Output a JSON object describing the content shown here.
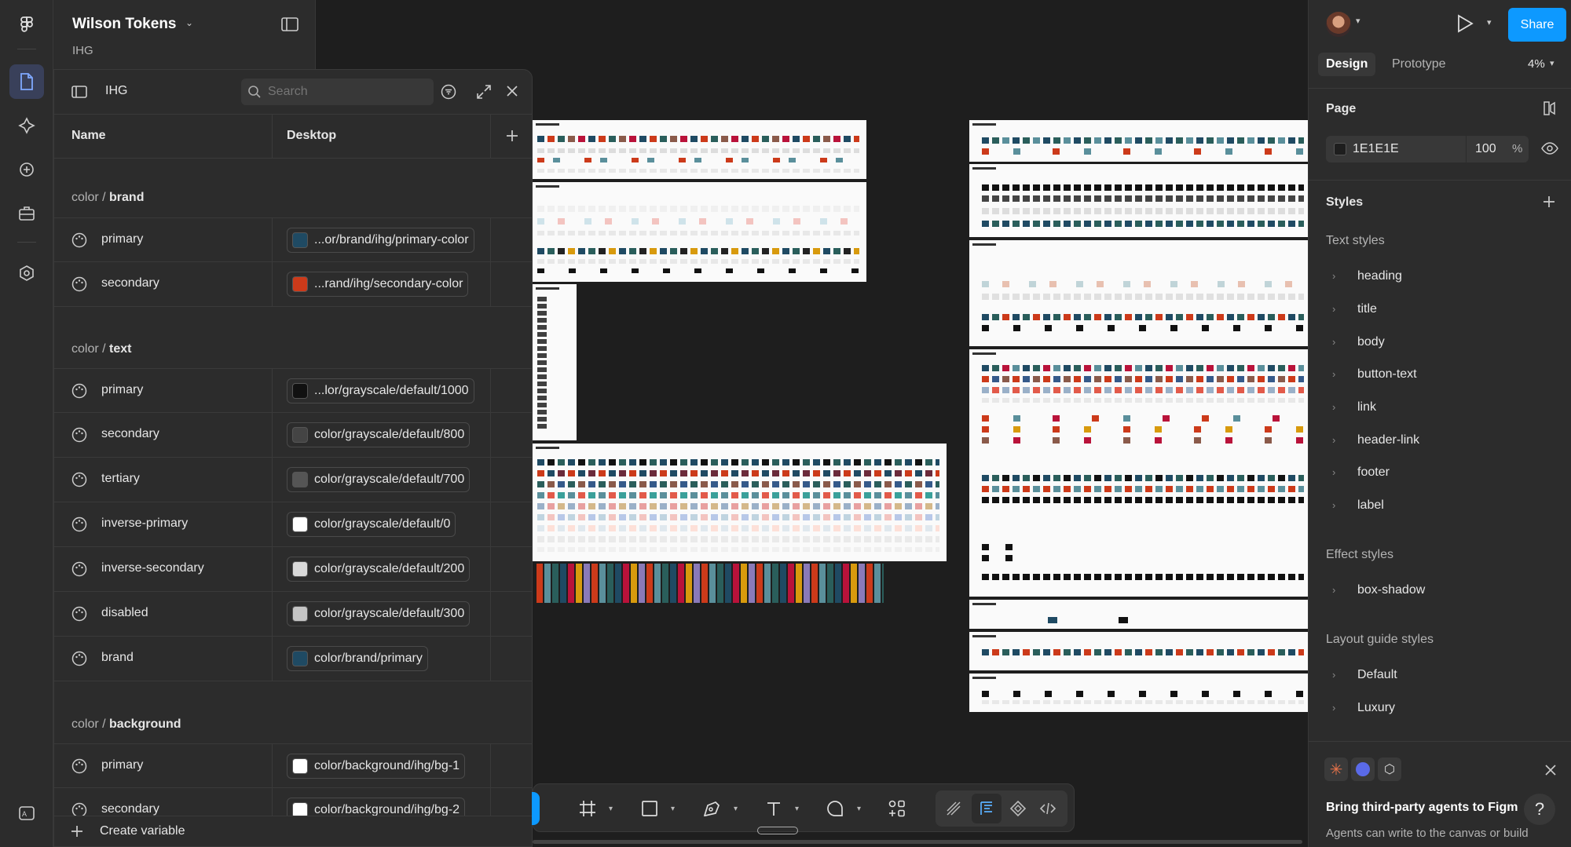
{
  "file": {
    "title": "Wilson Tokens",
    "subtitle": "IHG"
  },
  "variables_panel": {
    "collection": "IHG",
    "search_placeholder": "Search",
    "col_name": "Name",
    "col_mode": "Desktop",
    "groups": [
      {
        "prefix": "color / ",
        "name": "brand"
      },
      {
        "prefix": "color / ",
        "name": "text"
      },
      {
        "prefix": "color / ",
        "name": "background"
      }
    ],
    "rows": [
      {
        "name": "primary",
        "value": "...or/brand/ihg/primary-color",
        "color": "#1f4a63"
      },
      {
        "name": "secondary",
        "value": "...rand/ihg/secondary-color",
        "color": "#cc3a1a"
      },
      {
        "name": "primary",
        "value": "...lor/grayscale/default/1000",
        "color": "#111111"
      },
      {
        "name": "secondary",
        "value": "color/grayscale/default/800",
        "color": "#444444"
      },
      {
        "name": "tertiary",
        "value": "color/grayscale/default/700",
        "color": "#555555"
      },
      {
        "name": "inverse-primary",
        "value": "color/grayscale/default/0",
        "color": "#ffffff"
      },
      {
        "name": "inverse-secondary",
        "value": "color/grayscale/default/200",
        "color": "#d9d9d9"
      },
      {
        "name": "disabled",
        "value": "color/grayscale/default/300",
        "color": "#c4c4c4"
      },
      {
        "name": "brand",
        "value": "color/brand/primary",
        "color": "#1f4a63"
      },
      {
        "name": "primary",
        "value": "color/background/ihg/bg-1",
        "color": "#ffffff"
      },
      {
        "name": "secondary",
        "value": "color/background/ihg/bg-2",
        "color": "#ffffff"
      }
    ],
    "create_label": "Create variable"
  },
  "right_panel": {
    "share": "Share",
    "tab_design": "Design",
    "tab_prototype": "Prototype",
    "zoom": "4%",
    "page_label": "Page",
    "page_color": "1E1E1E",
    "page_opacity": "100",
    "percent": "%",
    "styles_label": "Styles",
    "text_styles_label": "Text styles",
    "text_styles": [
      "heading",
      "title",
      "body",
      "button-text",
      "link",
      "header-link",
      "footer",
      "label"
    ],
    "effect_styles_label": "Effect styles",
    "effect_styles": [
      "box-shadow"
    ],
    "layout_styles_label": "Layout guide styles",
    "layout_styles": [
      "Default",
      "Luxury"
    ],
    "promo_title": "Bring third-party agents to Figm",
    "promo_body": "Agents can write to the canvas or build"
  },
  "colors": {
    "accent": "#0d99ff",
    "panel": "#2c2c2c",
    "canvas": "#1e1e1e"
  }
}
